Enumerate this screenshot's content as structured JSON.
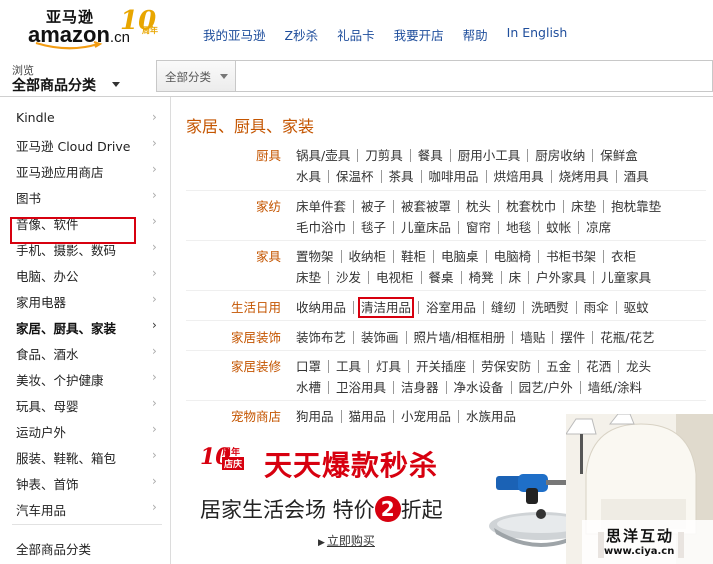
{
  "header": {
    "logo_cn": "亚马逊",
    "logo_en": "amazon",
    "logo_domain": ".cn",
    "anniv_number": "10",
    "anniv_text": "周年",
    "nav": [
      "我的亚马逊",
      "Z秒杀",
      "礼品卡",
      "我要开店",
      "帮助",
      "In English"
    ]
  },
  "browse": {
    "small": "浏览",
    "big": "全部商品分类"
  },
  "search": {
    "category": "全部分类"
  },
  "sidebar": {
    "items": [
      "Kindle",
      "亚马逊 Cloud Drive",
      "亚马逊应用商店",
      "图书",
      "音像、软件",
      "手机、摄影、数码",
      "电脑、办公",
      "家用电器",
      "家居、厨具、家装",
      "食品、酒水",
      "美妆、个护健康",
      "玩具、母婴",
      "运动户外",
      "服装、鞋靴、箱包",
      "钟表、首饰",
      "汽车用品"
    ],
    "all": "全部商品分类",
    "active_index": 8
  },
  "main": {
    "title": "家居、厨具、家装",
    "rows": [
      {
        "cat": "厨具",
        "lines": [
          [
            "锅具/壶具",
            "刀剪具",
            "餐具",
            "厨用小工具",
            "厨房收纳",
            "保鲜盒"
          ],
          [
            "水具",
            "保温杯",
            "茶具",
            "咖啡用品",
            "烘焙用具",
            "烧烤用具",
            "酒具"
          ]
        ]
      },
      {
        "cat": "家纺",
        "lines": [
          [
            "床单件套",
            "被子",
            "被套被罩",
            "枕头",
            "枕套枕巾",
            "床垫",
            "抱枕靠垫"
          ],
          [
            "毛巾浴巾",
            "毯子",
            "儿童床品",
            "窗帘",
            "地毯",
            "蚊帐",
            "凉席"
          ]
        ]
      },
      {
        "cat": "家具",
        "lines": [
          [
            "置物架",
            "收纳柜",
            "鞋柜",
            "电脑桌",
            "电脑椅",
            "书柜书架",
            "衣柜"
          ],
          [
            "床垫",
            "沙发",
            "电视柜",
            "餐桌",
            "椅凳",
            "床",
            "户外家具",
            "儿童家具"
          ]
        ]
      },
      {
        "cat": "生活日用",
        "lines": [
          [
            "收纳用品",
            "清洁用品",
            "浴室用品",
            "缝纫",
            "洗晒熨",
            "雨伞",
            "驱蚊"
          ]
        ]
      },
      {
        "cat": "家居装饰",
        "lines": [
          [
            "装饰布艺",
            "装饰画",
            "照片墙/相框相册",
            "墙贴",
            "摆件",
            "花瓶/花艺"
          ]
        ]
      },
      {
        "cat": "家居装修",
        "lines": [
          [
            "口罩",
            "工具",
            "灯具",
            "开关插座",
            "劳保安防",
            "五金",
            "花洒",
            "龙头"
          ],
          [
            "水槽",
            "卫浴用具",
            "洁身器",
            "净水设备",
            "园艺/户外",
            "墙纸/涂料"
          ]
        ]
      },
      {
        "cat": "宠物商店",
        "lines": [
          [
            "狗用品",
            "猫用品",
            "小宠用品",
            "水族用品"
          ]
        ]
      }
    ],
    "highlighted_link": "清洁用品"
  },
  "banner": {
    "badge_number": "10",
    "badge_line1": "周年",
    "badge_line2": "店庆",
    "headline": "天天爆款秒杀",
    "sub_before": "居家生活会场 特价",
    "sub_number": "2",
    "sub_after": "折起",
    "cta": "立即购买"
  },
  "watermark": {
    "cn": "思洋互动",
    "en": "www.ciya.cn"
  },
  "colors": {
    "accent": "#c45500",
    "link": "#1f4e9c",
    "highlight": "#d7000f"
  }
}
